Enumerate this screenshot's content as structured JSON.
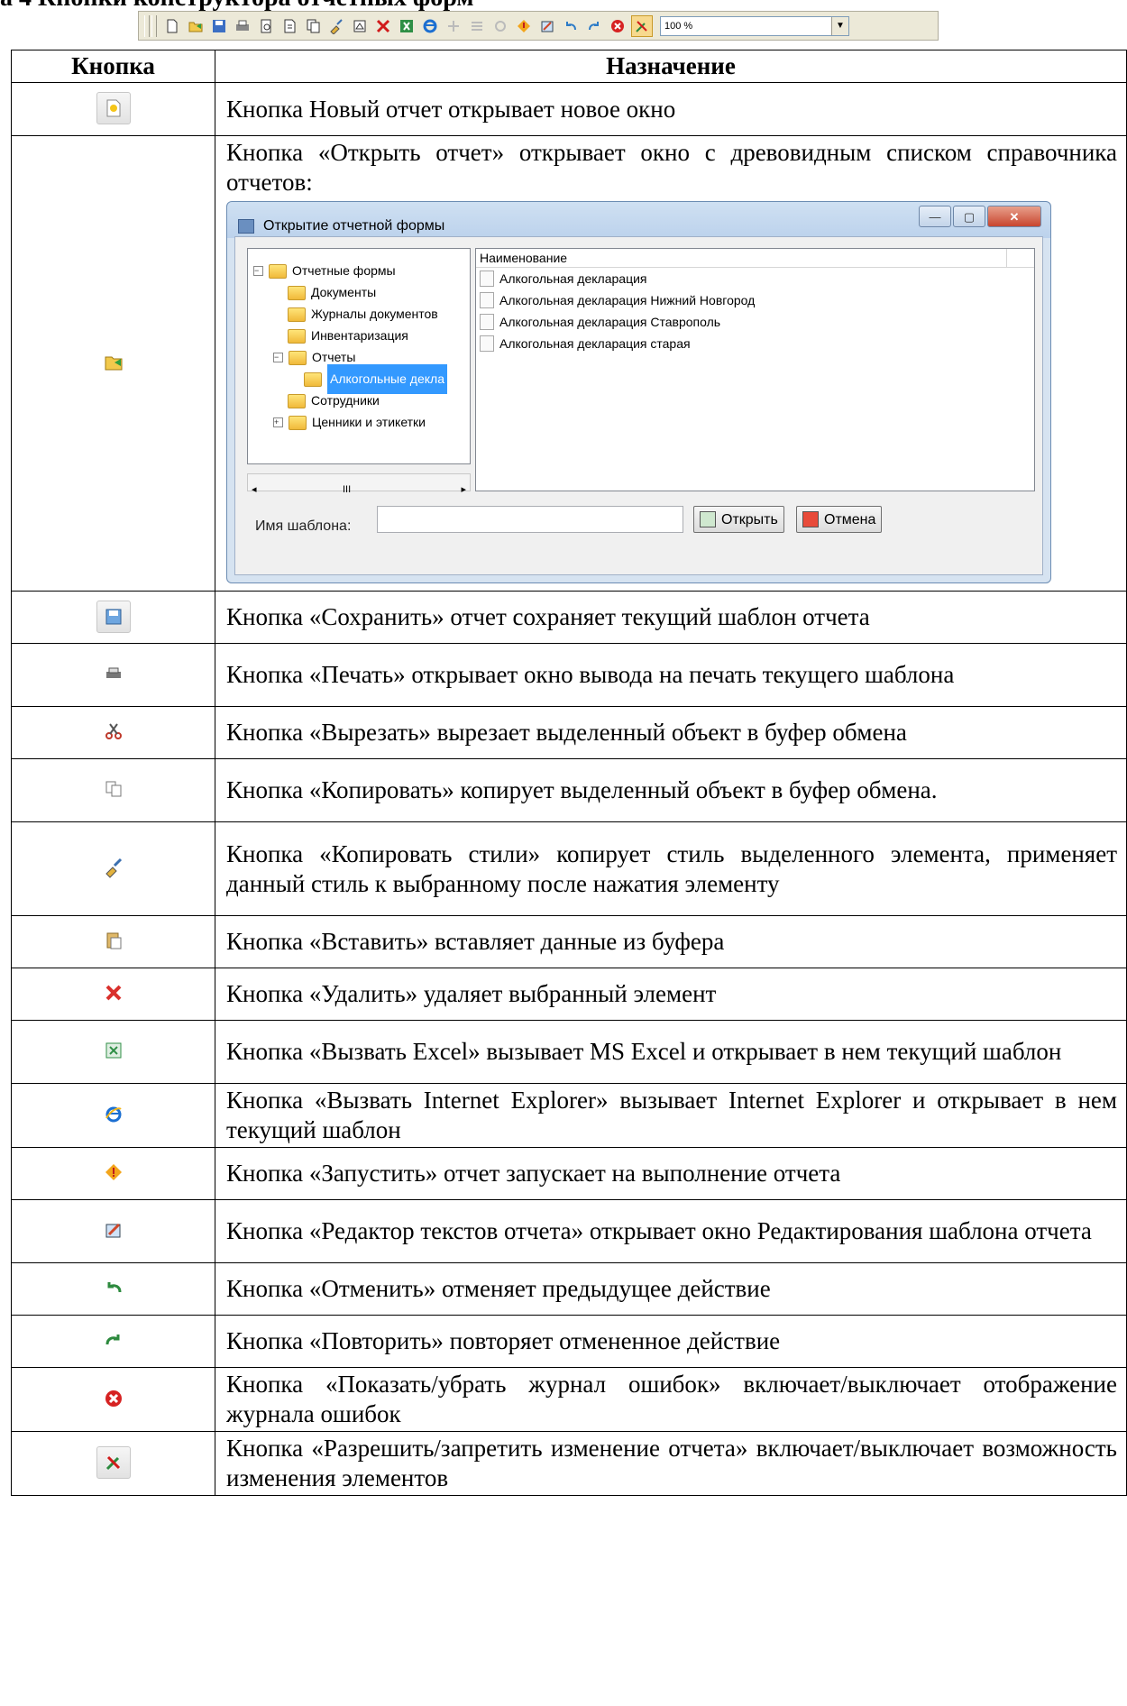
{
  "heading_partial": "а 4 Кнопки конструктора отчетных форм",
  "toolbar": {
    "icons": [
      "new-icon",
      "open-icon",
      "save-icon",
      "print-icon",
      "preview-icon",
      "export-icon",
      "copy-icon",
      "format-brush-icon",
      "page-icon",
      "delete-icon",
      "excel-icon",
      "ie-icon",
      "disabled-icon-1",
      "disabled-icon-2",
      "disabled-icon-3",
      "run-icon",
      "editor-icon",
      "undo-icon",
      "redo-icon",
      "error-log-icon",
      "toggle-edit-icon"
    ],
    "zoom": "100 %"
  },
  "table": {
    "header_button": "Кнопка",
    "header_purpose": "Назначение",
    "rows": [
      {
        "icon": "new-report-icon",
        "text": "Кнопка Новый отчет открывает новое окно"
      },
      {
        "icon": "open-report-icon",
        "text": "Кнопка «Открыть отчет» открывает окно с древовидным списком справочника отчетов:"
      },
      {
        "icon": "save-icon",
        "text": "Кнопка «Сохранить» отчет сохраняет текущий шаблон отчета"
      },
      {
        "icon": "print-icon",
        "text": "Кнопка «Печать» открывает окно вывода на печать текущего шаблона"
      },
      {
        "icon": "cut-icon",
        "text": "Кнопка «Вырезать» вырезает выделенный объект в буфер обмена"
      },
      {
        "icon": "copy-icon",
        "text": "Кнопка «Копировать» копирует выделенный объект в буфер обмена."
      },
      {
        "icon": "copy-style-icon",
        "text": "Кнопка «Копировать стили» копирует стиль выделенного элемента, применяет данный стиль к выбранному после нажатия элементу"
      },
      {
        "icon": "paste-icon",
        "text": "Кнопка «Вставить» вставляет данные из буфера"
      },
      {
        "icon": "delete-icon",
        "text": "Кнопка «Удалить» удаляет выбранный элемент"
      },
      {
        "icon": "excel-icon",
        "text": "Кнопка «Вызвать Excel» вызывает MS Excel и открывает в нем текущий шаблон"
      },
      {
        "icon": "ie-icon",
        "text": "Кнопка «Вызвать Internet Explorer» вызывает Internet Explorer и открывает в нем текущий шаблон"
      },
      {
        "icon": "run-icon",
        "text": "Кнопка «Запустить» отчет запускает на выполнение отчета"
      },
      {
        "icon": "editor-icon",
        "text": "Кнопка «Редактор текстов отчета» открывает окно Редактирования шаблона отчета"
      },
      {
        "icon": "undo-icon",
        "text": "Кнопка «Отменить» отменяет предыдущее действие"
      },
      {
        "icon": "redo-icon",
        "text": "Кнопка «Повторить» повторяет отмененное действие"
      },
      {
        "icon": "error-log-icon",
        "text": "Кнопка «Показать/убрать журнал ошибок» включает/выключает отображение журнала ошибок"
      },
      {
        "icon": "toggle-edit-icon",
        "text": "Кнопка «Разрешить/запретить изменение отчета» включает/выключает возможность изменения элементов"
      }
    ]
  },
  "dialog": {
    "title": "Открытие отчетной формы",
    "tree": {
      "root": "Отчетные формы",
      "items": [
        "Документы",
        "Журналы документов",
        "Инвентаризация",
        "Отчеты",
        "Алкогольные декла",
        "Сотрудники",
        "Ценники и этикетки"
      ]
    },
    "list_header": "Наименование",
    "list_items": [
      "Алкогольная декларация",
      "Алкогольная декларация Нижний Новгород",
      "Алкогольная декларация Ставрополь",
      "Алкогольная декларация старая"
    ],
    "template_label": "Имя шаблона:",
    "template_value": "",
    "open_button": "Открыть",
    "cancel_button": "Отмена",
    "scroll_marker": "III"
  }
}
